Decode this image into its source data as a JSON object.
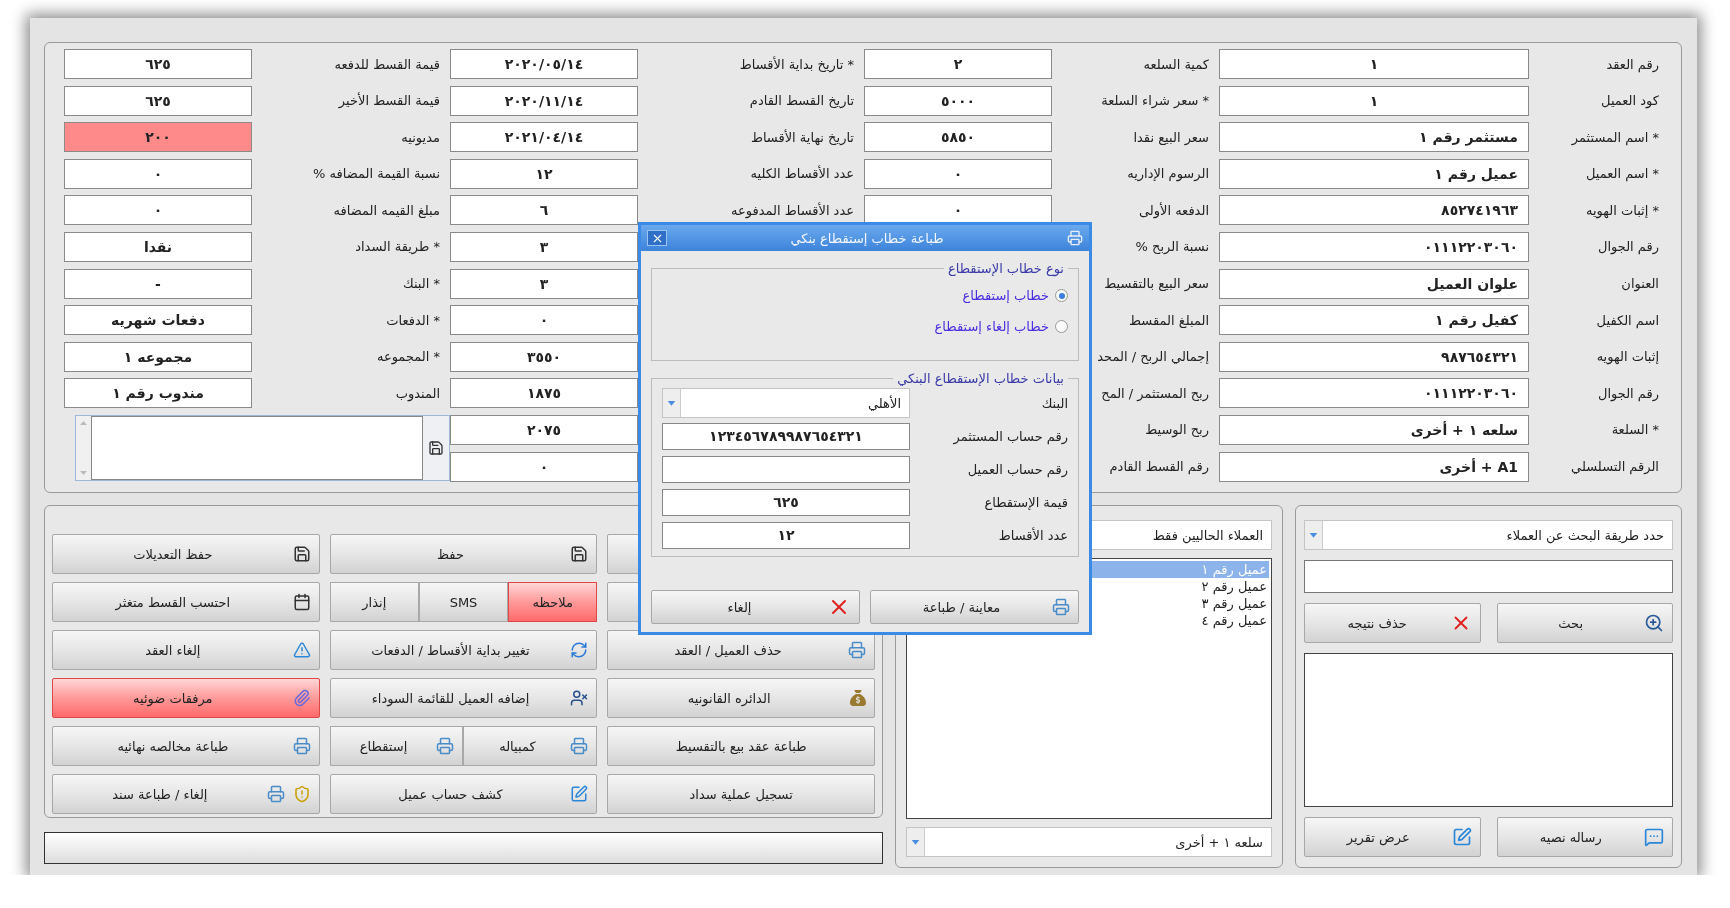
{
  "top_form": {
    "columns": [
      {
        "fields": [
          {
            "label": "رقم العقد",
            "value": "١"
          },
          {
            "label": "كود العميل",
            "value": "١"
          },
          {
            "label": "* اسم المستثمر",
            "value": "مستثمر رقم ١"
          },
          {
            "label": "* اسم العميل",
            "value": "عميل رقم ١"
          },
          {
            "label": "* إثبات الهويه",
            "value": "٨٥٢٧٤١٩٦٣"
          },
          {
            "label": "رقم الجوال",
            "value": "٠١١١٢٢٠٣٠٦٠"
          },
          {
            "label": "العنوان",
            "value": "علوان العميل"
          },
          {
            "label": "اسم الكفيل",
            "value": "كفيل رقم ١"
          },
          {
            "label": "إثبات الهويه",
            "value": "٩٨٧٦٥٤٣٢١"
          },
          {
            "label": "رقم الجوال",
            "value": "٠١١١٢٢٠٣٠٦٠"
          },
          {
            "label": "* السلعة",
            "value": "سلعه ١ + أخرى"
          },
          {
            "label": "الرقم التسلسلي",
            "value": "A1 + أخرى"
          }
        ]
      },
      {
        "fields": [
          {
            "label": "كمية السلعه",
            "value": "٢"
          },
          {
            "label": "* سعر شراء السلعة",
            "value": "٥٠٠٠"
          },
          {
            "label": "سعر البيع نقدا",
            "value": "٥٨٥٠"
          },
          {
            "label": "الرسوم الإداريه",
            "value": "٠"
          },
          {
            "label": "الدفعه الأولى",
            "value": "٠"
          },
          {
            "label": "نسبة الربح %"
          },
          {
            "label": "سعر البيع بالتقسيط"
          },
          {
            "label": "المبلغ المقسط"
          },
          {
            "label": "إجمالي الربح / المحد"
          },
          {
            "label": "ربح المستثمر / المح"
          },
          {
            "label": "ربح الوسيط"
          },
          {
            "label": "رقم القسط القادم"
          }
        ]
      },
      {
        "fields": [
          {
            "label": "* تاريخ بداية الأقساط",
            "value": "٢٠٢٠/٠٥/١٤"
          },
          {
            "label": "تاريخ القسط القادم",
            "value": "٢٠٢٠/١١/١٤"
          },
          {
            "label": "تاريخ نهاية الأقساط",
            "value": "٢٠٢١/٠٤/١٤"
          },
          {
            "label": "عدد الأقساط الكليه",
            "value": "١٢"
          },
          {
            "label": "عدد الأقساط المدفوعه",
            "value": "٦"
          },
          {
            "value": "٣"
          },
          {
            "value": "٣"
          },
          {
            "value": "٠"
          },
          {
            "value": "٣٥٥٠"
          },
          {
            "value": "١٨٧٥"
          },
          {
            "value": "٢٠٧٥"
          },
          {
            "value": "٠"
          }
        ]
      },
      {
        "fields": [
          {
            "label": "قيمة القسط للدفعه",
            "value": "٦٢٥",
            "highlighted": false
          },
          {
            "label": "قيمة القسط الأخير",
            "value": "٦٢٥",
            "highlighted": false
          },
          {
            "label": "مديونيه",
            "value": "٢٠٠",
            "highlighted": true
          },
          {
            "label": "نسبة القيمة المضافه %",
            "value": "٠",
            "highlighted": false
          },
          {
            "label": "مبلغ القيمه المضافه",
            "value": "٠",
            "highlighted": false
          },
          {
            "label": "* طريقة السداد",
            "value": "نقدا",
            "highlighted": false
          },
          {
            "label": "* البنك",
            "value": "-",
            "highlighted": false
          },
          {
            "label": "* الدفعات",
            "value": "دفعات شهريه",
            "highlighted": false
          },
          {
            "label": "* المجموعه",
            "value": "مجموعه ١",
            "highlighted": false
          },
          {
            "label": "المندوب",
            "value": "مندوب رقم ١",
            "highlighted": false
          }
        ]
      }
    ]
  },
  "button_grid": {
    "columns": [
      [
        {
          "kind": "single",
          "label": "حذف العميل / العقد",
          "highlighted": false
        },
        {
          "kind": "single",
          "label": "الدائره القانونيه",
          "highlighted": false
        },
        {
          "kind": "single",
          "label": "طباعة عقد بيع بالتقسيط",
          "highlighted": false
        },
        {
          "kind": "single",
          "label": "تسجيل عملية سداد",
          "highlighted": false
        }
      ],
      [
        {
          "kind": "single",
          "label": "حفظ",
          "highlighted": false
        },
        {
          "kind": "split",
          "parts": [
            {
              "label": "ملاحظه",
              "highlighted": true
            },
            {
              "label": "SMS",
              "highlighted": false
            },
            {
              "label": "إنذار",
              "highlighted": false
            }
          ]
        },
        {
          "kind": "single",
          "label": "تغيير بداية الأقساط / الدفعات",
          "highlighted": false
        },
        {
          "kind": "single",
          "label": "إضافه العميل للقائمة السوداء",
          "highlighted": false
        },
        {
          "kind": "split",
          "parts": [
            {
              "label": "كمبياله",
              "highlighted": false
            },
            {
              "label": "إستقطاع",
              "highlighted": false
            }
          ]
        },
        {
          "kind": "single",
          "label": "كشف حساب عميل",
          "highlighted": false
        }
      ],
      [
        {
          "kind": "single",
          "label": "حفظ التعديلات",
          "highlighted": false
        },
        {
          "kind": "single",
          "label": "احتسب القسط متغثر",
          "highlighted": false
        },
        {
          "kind": "single",
          "label": "إلغاء العقد",
          "highlighted": false
        },
        {
          "kind": "single",
          "label": "مرفقات ضوئيه",
          "highlighted": true
        },
        {
          "kind": "single",
          "label": "طباعة مخالصه نهائيه",
          "highlighted": false
        },
        {
          "kind": "single",
          "label": "إلغاء / طباعة سند",
          "highlighted": false
        }
      ]
    ]
  },
  "customer_list": {
    "filter": "العملاء الحاليين فقط",
    "items": [
      {
        "label": "عميل رقم ١",
        "selected": true
      },
      {
        "label": "عميل رقم ٢",
        "selected": false
      },
      {
        "label": "عميل رقم ٣",
        "selected": false
      },
      {
        "label": "عميل رقم ٤",
        "selected": false
      }
    ],
    "product_select": "سلعه ١ + أخرى"
  },
  "search_panel": {
    "method_select": "حدد طريقة البحث عن العملاء",
    "buttons": [
      "بحث",
      "حذف نتيجه"
    ],
    "bottom_buttons": [
      "رساله نصيه",
      "عرض تقرير"
    ]
  },
  "dialog": {
    "title": "طباعة خطاب إستقطاع بنكي",
    "type_group": {
      "title": "نوع خطاب الإستقطاع",
      "options": [
        {
          "label": "خطاب إستقطاع",
          "selected": true
        },
        {
          "label": "خطاب إلغاء إستقطاع",
          "selected": false
        }
      ]
    },
    "data_group": {
      "title": "بيانات خطاب الإستقطاع البنكي",
      "fields": [
        {
          "kind": "select",
          "label": "البنك",
          "value": "الأهلي"
        },
        {
          "kind": "text",
          "label": "رقم حساب المستثمر",
          "value": "١٢٣٤٥٦٧٨٩٩٨٧٦٥٤٣٢١"
        },
        {
          "kind": "text",
          "label": "رقم حساب العميل"
        },
        {
          "kind": "text",
          "label": "قيمة الإستقطاع",
          "value": "٦٢٥"
        },
        {
          "kind": "text",
          "label": "عدد الأقساط",
          "value": "١٢"
        }
      ]
    },
    "buttons": [
      "معاينة / طباعة",
      "إلغاء"
    ]
  }
}
